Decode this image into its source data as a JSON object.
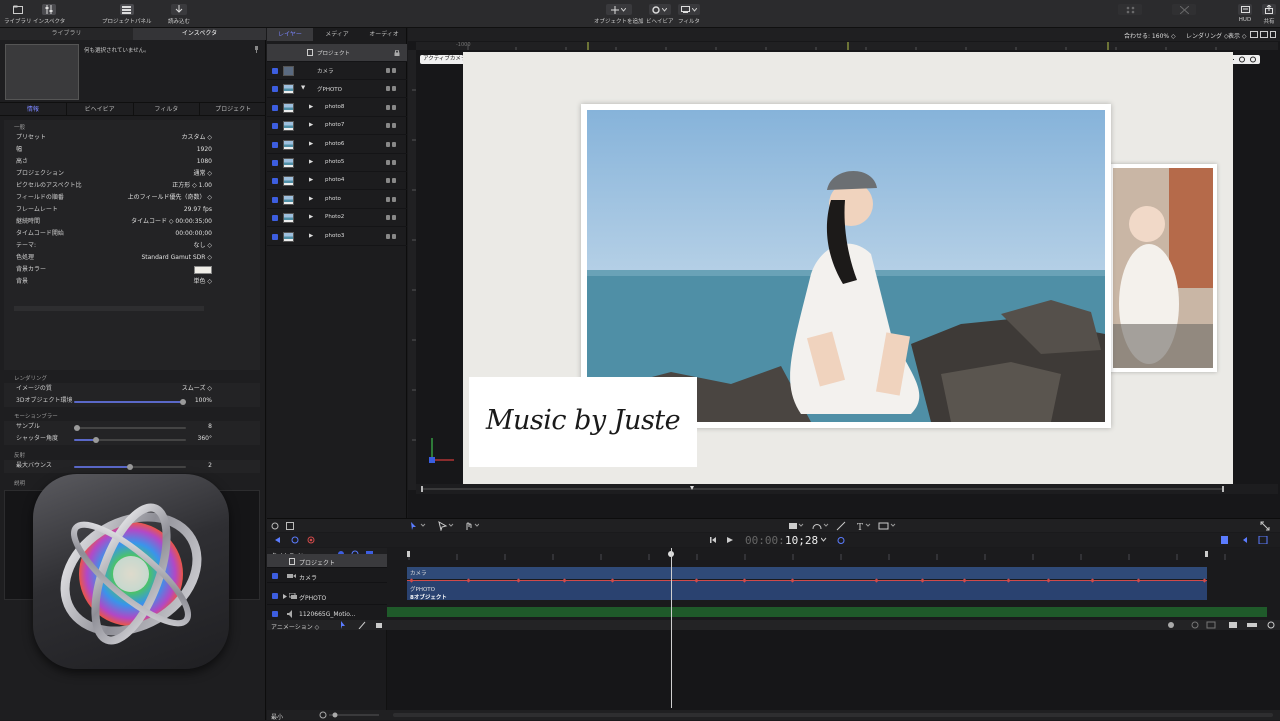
{
  "toolbar": {
    "library": "ライブラリ",
    "inspector": "インスペクタ",
    "project_panel": "プロジェクトパネル",
    "import": "読み込む",
    "add_object": "オブジェクトを追加",
    "behaviors": "ビヘイビア",
    "filters": "フィルタ",
    "hud": "HUD",
    "share": "共有"
  },
  "left_panel": {
    "tabs": [
      "ライブラリ",
      "インスペクタ"
    ],
    "preview_text": "何も選択されていません。",
    "sub_tabs": [
      "情報",
      "ビヘイビア",
      "フィルタ",
      "プロジェクト"
    ],
    "general_header": "一般",
    "props": [
      {
        "label": "プリセット",
        "value": "カスタム ◇"
      },
      {
        "label": "幅",
        "value": "1920"
      },
      {
        "label": "高さ",
        "value": "1080"
      },
      {
        "label": "プロジェクション",
        "value": "通常 ◇"
      },
      {
        "label": "ピクセルのアスペクト比",
        "value": "正方形 ◇   1.00"
      },
      {
        "label": "フィールドの順番",
        "value": "上のフィールド優先（奇数） ◇"
      },
      {
        "label": "フレームレート",
        "value": "29.97 fps"
      },
      {
        "label": "継続時間",
        "value": "タイムコード ◇   00:00:35;00"
      },
      {
        "label": "タイムコード開始",
        "value": "00:00:00;00"
      },
      {
        "label": "テーマ:",
        "value": "なし ◇"
      },
      {
        "label": "色処理",
        "value": "Standard Gamut SDR ◇"
      },
      {
        "label": "背景カラー",
        "value": ""
      },
      {
        "label": "背景",
        "value": "単色 ◇"
      }
    ],
    "rendering_header": "レンダリング",
    "image_quality_label": "イメージの質",
    "image_quality_value": "スムーズ ◇",
    "env3d_label": "3Dオブジェクト環境",
    "env3d_value": "100%",
    "env3d_level": 0.97,
    "motion_blur_header": "モーションブラー",
    "sample_label": "サンプル",
    "sample_value": "8",
    "sample_level": 0.03,
    "shutter_label": "シャッター角度",
    "shutter_value": "360°",
    "shutter_level": 0.2,
    "reflection_header": "反射",
    "max_bounce_label": "最大バウンス",
    "max_bounce_value": "2",
    "max_bounce_level": 0.5,
    "description_header": "説明"
  },
  "layers_panel": {
    "tabs": [
      "レイヤー",
      "メディア",
      "オーディオ"
    ],
    "project": "プロジェクト",
    "items": [
      {
        "name": "カメラ",
        "indent": 0
      },
      {
        "name": "グPHOTO",
        "indent": 0
      },
      {
        "name": "photo8",
        "indent": 1
      },
      {
        "name": "photo7",
        "indent": 1
      },
      {
        "name": "photo6",
        "indent": 1
      },
      {
        "name": "photo5",
        "indent": 1
      },
      {
        "name": "photo4",
        "indent": 1
      },
      {
        "name": "photo",
        "indent": 1
      },
      {
        "name": "Photo2",
        "indent": 1
      },
      {
        "name": "photo3",
        "indent": 1
      }
    ]
  },
  "canvas": {
    "zoom_label": "合わせる: 160% ◇",
    "render_label": "レンダリング ◇",
    "view_label": "表示 ◇",
    "camera_menu": "アクティブカメラ ◇",
    "ruler_mark": "-1000",
    "title_text": "Music by Juste"
  },
  "timeline": {
    "timecode_dim": "00:00:",
    "timecode": "10;28",
    "label": "タイムライン",
    "project": "プロジェクト",
    "tracks": [
      "カメラ",
      "グPHOTO",
      "1120665G_Motio..."
    ],
    "camera_bar": "カメラ",
    "group_bar": "グPHOTO",
    "group_sub": "8オブジェクト",
    "animation": "アニメーション ◇",
    "zoom_label": "最小"
  }
}
